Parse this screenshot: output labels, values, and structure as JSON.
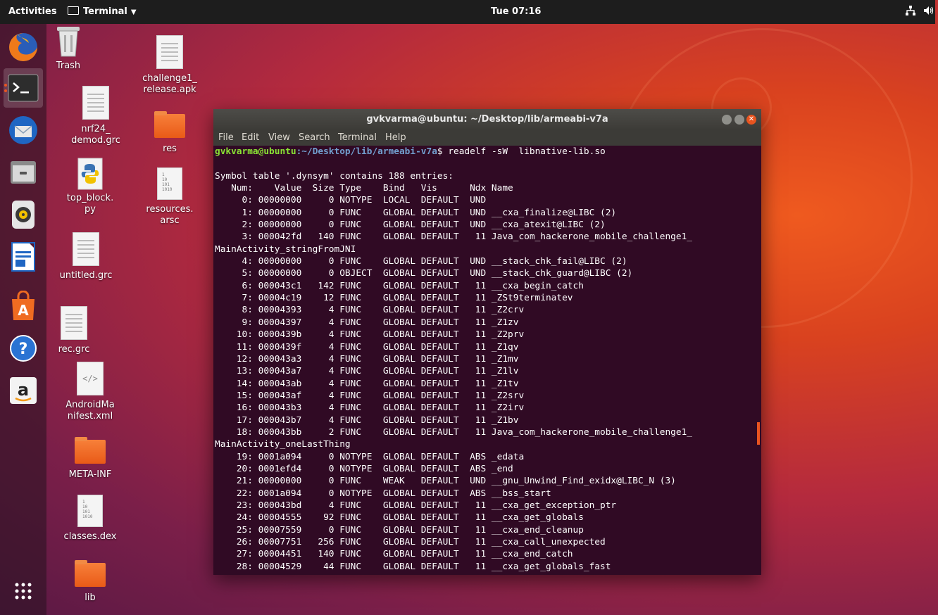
{
  "topbar": {
    "activities": "Activities",
    "app_menu": "Terminal",
    "clock": "Tue 07:16"
  },
  "dock": {
    "apps": [
      "firefox-icon",
      "terminal-icon",
      "thunderbird-icon",
      "files-icon",
      "rhythmbox-icon",
      "libreoffice-writer-icon",
      "software-center-icon",
      "help-icon",
      "amazon-icon"
    ],
    "show_apps": "show-applications-icon"
  },
  "desktop": {
    "icons": [
      {
        "label": "Trash",
        "kind": "trash"
      },
      {
        "label": "challenge1_\nrelease.apk",
        "kind": "file"
      },
      {
        "label": "nrf24_\ndemod.grc",
        "kind": "file"
      },
      {
        "label": "res",
        "kind": "folder"
      },
      {
        "label": "top_block.\npy",
        "kind": "python"
      },
      {
        "label": "resources.\narsc",
        "kind": "binary"
      },
      {
        "label": "untitled.grc",
        "kind": "file"
      },
      {
        "label": "rec.grc",
        "kind": "file"
      },
      {
        "label": "AndroidMa\nnifest.xml",
        "kind": "xml"
      },
      {
        "label": "META-INF",
        "kind": "folder"
      },
      {
        "label": "classes.dex",
        "kind": "binary"
      },
      {
        "label": "lib",
        "kind": "folder"
      }
    ]
  },
  "terminal": {
    "title": "gvkvarma@ubuntu: ~/Desktop/lib/armeabi-v7a",
    "menu": [
      "File",
      "Edit",
      "View",
      "Search",
      "Terminal",
      "Help"
    ],
    "prompt_user": "gvkvarma@ubuntu",
    "prompt_path": ":~/Desktop/lib/armeabi-v7a",
    "prompt_cmd": "$ readelf -sW  libnative-lib.so",
    "lines": [
      "",
      "Symbol table '.dynsym' contains 188 entries:",
      "   Num:    Value  Size Type    Bind   Vis      Ndx Name",
      "     0: 00000000     0 NOTYPE  LOCAL  DEFAULT  UND",
      "     1: 00000000     0 FUNC    GLOBAL DEFAULT  UND __cxa_finalize@LIBC (2)",
      "     2: 00000000     0 FUNC    GLOBAL DEFAULT  UND __cxa_atexit@LIBC (2)",
      "     3: 000042fd   140 FUNC    GLOBAL DEFAULT   11 Java_com_hackerone_mobile_challenge1_",
      "MainActivity_stringFromJNI",
      "     4: 00000000     0 FUNC    GLOBAL DEFAULT  UND __stack_chk_fail@LIBC (2)",
      "     5: 00000000     0 OBJECT  GLOBAL DEFAULT  UND __stack_chk_guard@LIBC (2)",
      "     6: 000043c1   142 FUNC    GLOBAL DEFAULT   11 __cxa_begin_catch",
      "     7: 00004c19    12 FUNC    GLOBAL DEFAULT   11 _ZSt9terminatev",
      "     8: 00004393     4 FUNC    GLOBAL DEFAULT   11 _Z2crv",
      "     9: 00004397     4 FUNC    GLOBAL DEFAULT   11 _Z1zv",
      "    10: 0000439b     4 FUNC    GLOBAL DEFAULT   11 _Z2prv",
      "    11: 0000439f     4 FUNC    GLOBAL DEFAULT   11 _Z1qv",
      "    12: 000043a3     4 FUNC    GLOBAL DEFAULT   11 _Z1mv",
      "    13: 000043a7     4 FUNC    GLOBAL DEFAULT   11 _Z1lv",
      "    14: 000043ab     4 FUNC    GLOBAL DEFAULT   11 _Z1tv",
      "    15: 000043af     4 FUNC    GLOBAL DEFAULT   11 _Z2srv",
      "    16: 000043b3     4 FUNC    GLOBAL DEFAULT   11 _Z2irv",
      "    17: 000043b7     4 FUNC    GLOBAL DEFAULT   11 _Z1bv",
      "    18: 000043bb     2 FUNC    GLOBAL DEFAULT   11 Java_com_hackerone_mobile_challenge1_",
      "MainActivity_oneLastThing",
      "    19: 0001a094     0 NOTYPE  GLOBAL DEFAULT  ABS _edata",
      "    20: 0001efd4     0 NOTYPE  GLOBAL DEFAULT  ABS _end",
      "    21: 00000000     0 FUNC    WEAK   DEFAULT  UND __gnu_Unwind_Find_exidx@LIBC_N (3)",
      "    22: 0001a094     0 NOTYPE  GLOBAL DEFAULT  ABS __bss_start",
      "    23: 000043bd     4 FUNC    GLOBAL DEFAULT   11 __cxa_get_exception_ptr",
      "    24: 00004555    92 FUNC    GLOBAL DEFAULT   11 __cxa_get_globals",
      "    25: 00007559     0 FUNC    GLOBAL DEFAULT   11 __cxa_end_cleanup",
      "    26: 00007751   256 FUNC    GLOBAL DEFAULT   11 __cxa_call_unexpected",
      "    27: 00004451   140 FUNC    GLOBAL DEFAULT   11 __cxa_end_catch",
      "    28: 00004529    44 FUNC    GLOBAL DEFAULT   11 __cxa_get_globals_fast"
    ]
  }
}
